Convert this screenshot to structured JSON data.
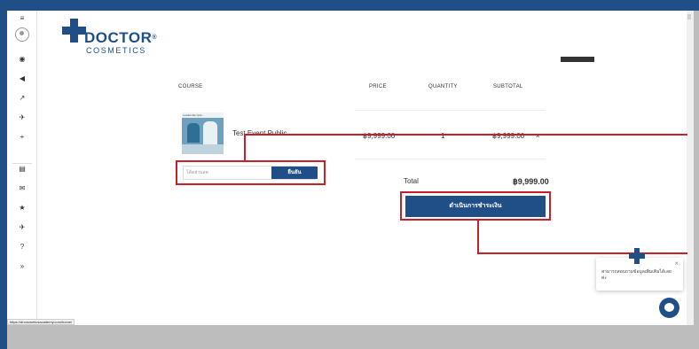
{
  "brand": {
    "name": "DOCTOR",
    "reg": "®",
    "tagline": "COSMETICS"
  },
  "sidebar": {
    "icons": [
      {
        "name": "menu-icon",
        "glyph": "≡"
      },
      {
        "name": "gauge-icon",
        "glyph": "◉"
      },
      {
        "name": "megaphone-icon",
        "glyph": "◀"
      },
      {
        "name": "chart-icon",
        "glyph": "↗"
      },
      {
        "name": "rocket-icon",
        "glyph": "✈"
      },
      {
        "name": "plus-icon",
        "glyph": "+"
      },
      {
        "name": "database-icon",
        "glyph": "▤"
      },
      {
        "name": "mail-icon",
        "glyph": "✉"
      },
      {
        "name": "star-icon",
        "glyph": "★"
      },
      {
        "name": "rocket-icon-2",
        "glyph": "✈"
      },
      {
        "name": "help-icon",
        "glyph": "?"
      },
      {
        "name": "collapse-icon",
        "glyph": "»"
      }
    ]
  },
  "cart": {
    "headers": {
      "course": "COURSE",
      "price": "PRICE",
      "quantity": "QUANTITY",
      "subtotal": "SUBTOTAL"
    },
    "item": {
      "name": "Test Event Public",
      "price": "฿9,999.00",
      "quantity": "1",
      "subtotal": "฿9,999.00",
      "remove": "×",
      "thumb_caption": "Leadership Quin..."
    },
    "coupon": {
      "placeholder": "โค้ดส่วนลด",
      "apply_label": "ยืนยัน"
    },
    "total_label": "Total",
    "total_value": "฿9,999.00",
    "checkout_label": "ดำเนินการชำระเงิน"
  },
  "chat": {
    "message": "สามารถสอบถามข้อมูลเพิ่มเติมได้เลยค่ะ",
    "close": "×"
  },
  "status_bar": {
    "url": "https://drcosmeticsacademy.com/home/"
  },
  "colors": {
    "brand": "#1f4f86",
    "annotation": "#c8202a"
  }
}
